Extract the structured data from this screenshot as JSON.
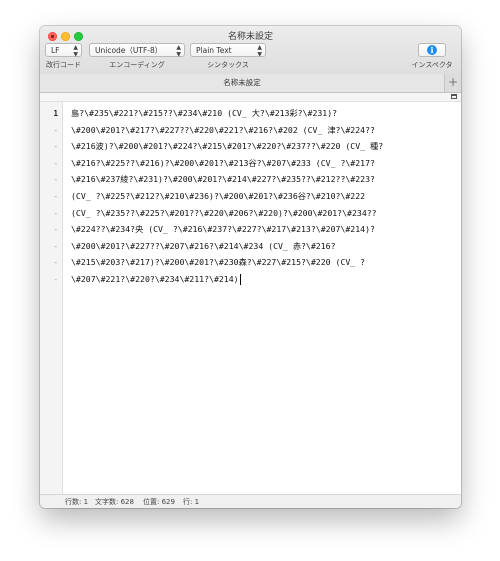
{
  "window": {
    "title": "名称未設定"
  },
  "toolbar": {
    "line_ending": {
      "value": "LF",
      "label": "改行コード"
    },
    "encoding": {
      "value": "Unicode（UTF-8）",
      "label": "エンコーディング"
    },
    "syntax": {
      "value": "Plain Text",
      "label": "シンタックス"
    },
    "inspector": {
      "label": "インスペクタ"
    }
  },
  "tab": {
    "title": "名称未設定",
    "add_symbol": "+"
  },
  "gutter": {
    "numbers": [
      "1",
      "-",
      "-",
      "-",
      "-",
      "-",
      "-",
      "-",
      "-",
      "-",
      "-"
    ]
  },
  "editor": {
    "lines": [
      "島?\\#235\\#221?\\#215??\\#234\\#210 (CV_ 大?\\#213彩?\\#231)?",
      "\\#200\\#201?\\#217?\\#227??\\#220\\#221?\\#216?\\#202 (CV_ 津?\\#224??",
      "\\#216波)?\\#200\\#201?\\#224?\\#215\\#201?\\#220?\\#237??\\#220 (CV_ 種?",
      "\\#216?\\#225??\\#216)?\\#200\\#201?\\#213谷?\\#207\\#233 (CV_ ?\\#217?",
      "\\#216\\#237綾?\\#231)?\\#200\\#201?\\#214\\#227?\\#235??\\#212??\\#223?",
      "(CV_ ?\\#225?\\#212?\\#210\\#236)?\\#200\\#201?\\#236谷?\\#210?\\#222",
      "(CV_ ?\\#235??\\#225?\\#201??\\#220\\#206?\\#220)?\\#200\\#201?\\#234??",
      "\\#224??\\#234?央 (CV_ ?\\#216\\#237?\\#227?\\#217\\#213?\\#207\\#214)?",
      "\\#200\\#201?\\#227??\\#207\\#216?\\#214\\#234 (CV_ 赤?\\#216?",
      "\\#215\\#203?\\#217)?\\#200\\#201?\\#230森?\\#227\\#215?\\#220 (CV_ ?",
      "\\#207\\#221?\\#220?\\#234\\#211?\\#214)"
    ]
  },
  "statusbar": {
    "lines": "行数: 1",
    "chars": "文字数: 628",
    "position": "位置: 629",
    "row": "行: 1"
  }
}
